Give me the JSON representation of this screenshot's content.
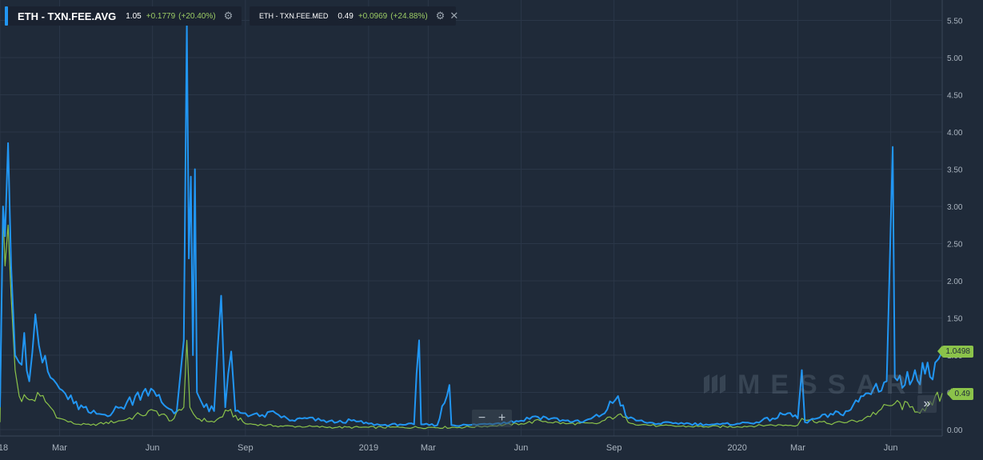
{
  "legend": [
    {
      "symbol": "ETH - TXN.FEE.AVG",
      "value": "1.05",
      "change": "+0.1779",
      "change_pct": "(+20.40%)",
      "color": "#2196f3",
      "settings_icon": "gear-icon"
    },
    {
      "symbol": "ETH - TXN.FEE.MED",
      "value": "0.49",
      "change": "+0.0969",
      "change_pct": "(+24.88%)",
      "color": "#8bc34a",
      "settings_icon": "gear-icon",
      "close_icon": "close-icon"
    }
  ],
  "price_labels": {
    "avg": "1.0498",
    "med": "0.49"
  },
  "watermark": "MESSARI",
  "zoom": {
    "minus": "−",
    "plus": "+"
  },
  "scroll_right": "»",
  "colors": {
    "background": "#1f2a39",
    "grid": "#2b3748",
    "avg": "#2196f3",
    "med": "#8bc34a"
  },
  "chart_data": {
    "type": "line",
    "x_ticks": [
      "18",
      "Mar",
      "Jun",
      "Sep",
      "2019",
      "Mar",
      "Jun",
      "Sep",
      "2020",
      "Mar",
      "Jun"
    ],
    "y_ticks": [
      "0.00",
      "0.50",
      "1.00",
      "1.50",
      "2.00",
      "2.50",
      "3.00",
      "3.50",
      "4.00",
      "4.50",
      "5.00",
      "5.50"
    ],
    "ylim": [
      0,
      5.6
    ],
    "xlim": [
      "2018-01-01",
      "2020-07-22"
    ],
    "y_axis_position": "right",
    "grid": true,
    "series": [
      {
        "name": "ETH - TXN.FEE.AVG",
        "color": "#2196f3",
        "points": [
          [
            "2018-01-01",
            0.3
          ],
          [
            "2018-01-04",
            3.0
          ],
          [
            "2018-01-06",
            2.6
          ],
          [
            "2018-01-09",
            3.85
          ],
          [
            "2018-01-12",
            2.2
          ],
          [
            "2018-01-16",
            1.0
          ],
          [
            "2018-01-20",
            0.9
          ],
          [
            "2018-01-25",
            1.3
          ],
          [
            "2018-01-30",
            0.65
          ],
          [
            "2018-02-05",
            1.55
          ],
          [
            "2018-02-12",
            0.9
          ],
          [
            "2018-02-20",
            0.7
          ],
          [
            "2018-03-01",
            0.55
          ],
          [
            "2018-03-15",
            0.35
          ],
          [
            "2018-04-01",
            0.22
          ],
          [
            "2018-04-15",
            0.2
          ],
          [
            "2018-05-01",
            0.3
          ],
          [
            "2018-05-15",
            0.45
          ],
          [
            "2018-05-25",
            0.55
          ],
          [
            "2018-06-05",
            0.45
          ],
          [
            "2018-06-15",
            0.3
          ],
          [
            "2018-06-25",
            0.25
          ],
          [
            "2018-07-02",
            1.2
          ],
          [
            "2018-07-05",
            5.45
          ],
          [
            "2018-07-07",
            2.3
          ],
          [
            "2018-07-09",
            3.4
          ],
          [
            "2018-07-11",
            1.0
          ],
          [
            "2018-07-13",
            3.5
          ],
          [
            "2018-07-15",
            0.5
          ],
          [
            "2018-07-22",
            0.3
          ],
          [
            "2018-08-01",
            0.25
          ],
          [
            "2018-08-08",
            1.8
          ],
          [
            "2018-08-12",
            0.3
          ],
          [
            "2018-08-18",
            1.05
          ],
          [
            "2018-08-22",
            0.25
          ],
          [
            "2018-09-01",
            0.22
          ],
          [
            "2018-09-15",
            0.18
          ],
          [
            "2018-10-01",
            0.22
          ],
          [
            "2018-10-15",
            0.12
          ],
          [
            "2018-11-01",
            0.15
          ],
          [
            "2018-11-15",
            0.12
          ],
          [
            "2018-12-01",
            0.1
          ],
          [
            "2018-12-15",
            0.12
          ],
          [
            "2019-01-01",
            0.08
          ],
          [
            "2019-01-15",
            0.06
          ],
          [
            "2019-02-01",
            0.07
          ],
          [
            "2019-02-15",
            0.07
          ],
          [
            "2019-02-20",
            1.2
          ],
          [
            "2019-02-22",
            0.07
          ],
          [
            "2019-03-10",
            0.06
          ],
          [
            "2019-03-22",
            0.6
          ],
          [
            "2019-03-24",
            0.06
          ],
          [
            "2019-04-10",
            0.06
          ],
          [
            "2019-05-01",
            0.08
          ],
          [
            "2019-05-15",
            0.1
          ],
          [
            "2019-06-01",
            0.12
          ],
          [
            "2019-06-15",
            0.18
          ],
          [
            "2019-07-01",
            0.15
          ],
          [
            "2019-07-15",
            0.12
          ],
          [
            "2019-08-01",
            0.1
          ],
          [
            "2019-08-20",
            0.2
          ],
          [
            "2019-09-05",
            0.45
          ],
          [
            "2019-09-15",
            0.15
          ],
          [
            "2019-10-01",
            0.1
          ],
          [
            "2019-10-15",
            0.08
          ],
          [
            "2019-11-01",
            0.09
          ],
          [
            "2019-11-15",
            0.08
          ],
          [
            "2019-12-01",
            0.07
          ],
          [
            "2019-12-15",
            0.07
          ],
          [
            "2020-01-01",
            0.08
          ],
          [
            "2020-01-20",
            0.1
          ],
          [
            "2020-02-05",
            0.15
          ],
          [
            "2020-02-20",
            0.22
          ],
          [
            "2020-03-01",
            0.15
          ],
          [
            "2020-03-05",
            0.8
          ],
          [
            "2020-03-08",
            0.1
          ],
          [
            "2020-03-20",
            0.15
          ],
          [
            "2020-04-05",
            0.2
          ],
          [
            "2020-04-20",
            0.25
          ],
          [
            "2020-05-05",
            0.45
          ],
          [
            "2020-05-15",
            0.55
          ],
          [
            "2020-05-28",
            0.65
          ],
          [
            "2020-06-03",
            3.8
          ],
          [
            "2020-06-05",
            0.7
          ],
          [
            "2020-06-15",
            0.6
          ],
          [
            "2020-06-25",
            0.8
          ],
          [
            "2020-07-05",
            0.75
          ],
          [
            "2020-07-15",
            0.9
          ],
          [
            "2020-07-22",
            1.05
          ]
        ]
      },
      {
        "name": "ETH - TXN.FEE.MED",
        "color": "#8bc34a",
        "points": [
          [
            "2018-01-01",
            0.1
          ],
          [
            "2018-01-04",
            2.9
          ],
          [
            "2018-01-06",
            2.2
          ],
          [
            "2018-01-09",
            2.75
          ],
          [
            "2018-01-12",
            1.8
          ],
          [
            "2018-01-16",
            0.8
          ],
          [
            "2018-01-20",
            0.45
          ],
          [
            "2018-01-30",
            0.4
          ],
          [
            "2018-02-10",
            0.45
          ],
          [
            "2018-02-20",
            0.3
          ],
          [
            "2018-03-01",
            0.15
          ],
          [
            "2018-03-15",
            0.08
          ],
          [
            "2018-04-01",
            0.06
          ],
          [
            "2018-05-01",
            0.12
          ],
          [
            "2018-05-20",
            0.2
          ],
          [
            "2018-06-05",
            0.25
          ],
          [
            "2018-06-20",
            0.12
          ],
          [
            "2018-07-02",
            0.3
          ],
          [
            "2018-07-05",
            1.2
          ],
          [
            "2018-07-08",
            0.3
          ],
          [
            "2018-07-15",
            0.15
          ],
          [
            "2018-08-01",
            0.1
          ],
          [
            "2018-08-15",
            0.25
          ],
          [
            "2018-09-01",
            0.08
          ],
          [
            "2018-10-01",
            0.05
          ],
          [
            "2018-11-01",
            0.04
          ],
          [
            "2018-12-01",
            0.03
          ],
          [
            "2019-01-01",
            0.03
          ],
          [
            "2019-02-01",
            0.03
          ],
          [
            "2019-03-01",
            0.03
          ],
          [
            "2019-04-01",
            0.03
          ],
          [
            "2019-05-01",
            0.05
          ],
          [
            "2019-06-01",
            0.08
          ],
          [
            "2019-06-20",
            0.12
          ],
          [
            "2019-07-15",
            0.08
          ],
          [
            "2019-08-15",
            0.08
          ],
          [
            "2019-09-05",
            0.2
          ],
          [
            "2019-09-20",
            0.08
          ],
          [
            "2019-10-15",
            0.05
          ],
          [
            "2019-12-01",
            0.04
          ],
          [
            "2020-01-01",
            0.04
          ],
          [
            "2020-02-01",
            0.06
          ],
          [
            "2020-03-01",
            0.06
          ],
          [
            "2020-03-05",
            0.15
          ],
          [
            "2020-04-01",
            0.08
          ],
          [
            "2020-05-01",
            0.12
          ],
          [
            "2020-05-20",
            0.25
          ],
          [
            "2020-06-05",
            0.35
          ],
          [
            "2020-06-20",
            0.3
          ],
          [
            "2020-07-05",
            0.25
          ],
          [
            "2020-07-22",
            0.49
          ]
        ]
      }
    ]
  }
}
